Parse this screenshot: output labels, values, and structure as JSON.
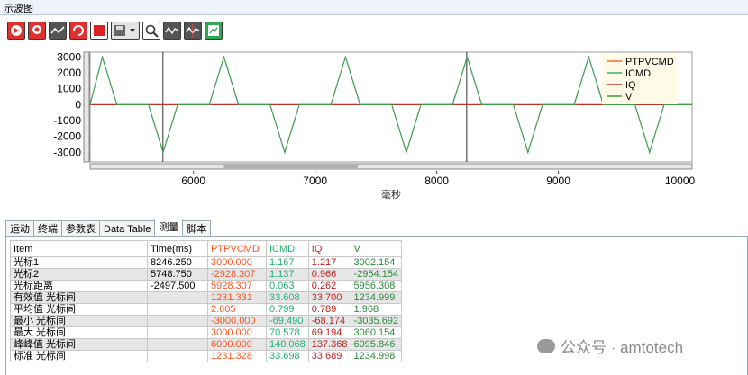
{
  "window": {
    "title": "示波图"
  },
  "toolbar": {
    "icons": [
      "play-icon",
      "record-icon",
      "line-icon",
      "swirl-icon",
      "stop-icon",
      "save-dropdown-icon",
      "zoom-icon",
      "wave-icon",
      "cursor-wave-icon",
      "export-icon"
    ]
  },
  "chart_data": {
    "type": "line",
    "xlabel": "毫秒",
    "ylabel": "",
    "xlim": [
      5150,
      10100
    ],
    "ylim": [
      -3600,
      3300
    ],
    "x_ticks": [
      6000,
      7000,
      8000,
      9000,
      10000
    ],
    "y_ticks": [
      3000,
      2000,
      1000,
      0,
      -1000,
      -2000,
      -3000
    ],
    "x_tick_labels": [
      "6000",
      "7000",
      "8000",
      "9000",
      "10000"
    ],
    "y_tick_labels": [
      "3000",
      "2000",
      "1000",
      "0",
      "-1000",
      "-2000",
      "-3000"
    ],
    "legend_position": "top-right",
    "cursors": [
      5748.75,
      8246.25
    ],
    "series": [
      {
        "name": "PTPVCMD",
        "color": "#ff6633",
        "pulses": [
          [
            5150,
            0,
            0
          ],
          [
            5250,
            0,
            5
          ],
          [
            5500,
            0,
            5
          ]
        ]
      },
      {
        "name": "ICMD",
        "color": "#2db36b",
        "pulses": []
      },
      {
        "name": "IQ",
        "color": "#cc2222",
        "pulses": []
      },
      {
        "name": "V",
        "color": "#3c9c4c",
        "pulses": [
          [
            5250,
            3000
          ],
          [
            5750,
            -3000
          ],
          [
            6250,
            3000
          ],
          [
            6750,
            -3000
          ],
          [
            7250,
            3000
          ],
          [
            7750,
            -3000
          ],
          [
            8250,
            3000
          ],
          [
            8750,
            -3000
          ],
          [
            9250,
            3000
          ],
          [
            9750,
            -3000
          ]
        ]
      }
    ],
    "pulse_half_width_ms": 120,
    "grid": false
  },
  "tabs": [
    {
      "label": "运动"
    },
    {
      "label": "终端"
    },
    {
      "label": "参数表"
    },
    {
      "label": "Data Table"
    },
    {
      "label": "测量"
    },
    {
      "label": "脚本"
    }
  ],
  "table": {
    "headers": [
      "Item",
      "Time(ms)",
      "PTPVCMD",
      "ICMD",
      "IQ",
      "V"
    ],
    "rows": [
      [
        "光标1",
        "8246.250",
        "3000.000",
        "1.167",
        "1.217",
        "3002.154"
      ],
      [
        "光标2",
        "5748.750",
        "-2928.307",
        "1.137",
        "0.966",
        "-2954.154"
      ],
      [
        "光标距离",
        "-2497.500",
        "5928.307",
        "0.063",
        "0.262",
        "5956.308"
      ],
      [
        "有效值 光标间",
        "",
        "1231.331",
        "33.608",
        "33.700",
        "1234.999"
      ],
      [
        "平均值 光标间",
        "",
        "2.605",
        "0.799",
        "0.789",
        "1.968"
      ],
      [
        "最小 光标间",
        "",
        "-3000.000",
        "-69.490",
        "-68.174",
        "-3035.692"
      ],
      [
        "最大 光标间",
        "",
        "3000.000",
        "70.578",
        "69.194",
        "3060.154"
      ],
      [
        "峰峰值 光标间",
        "",
        "6000.000",
        "140.068",
        "137.368",
        "6095.846"
      ],
      [
        "标准 光标间",
        "",
        "1231.328",
        "33.698",
        "33.689",
        "1234.998"
      ]
    ]
  },
  "watermark": {
    "text": "公众号 · amtotech"
  }
}
